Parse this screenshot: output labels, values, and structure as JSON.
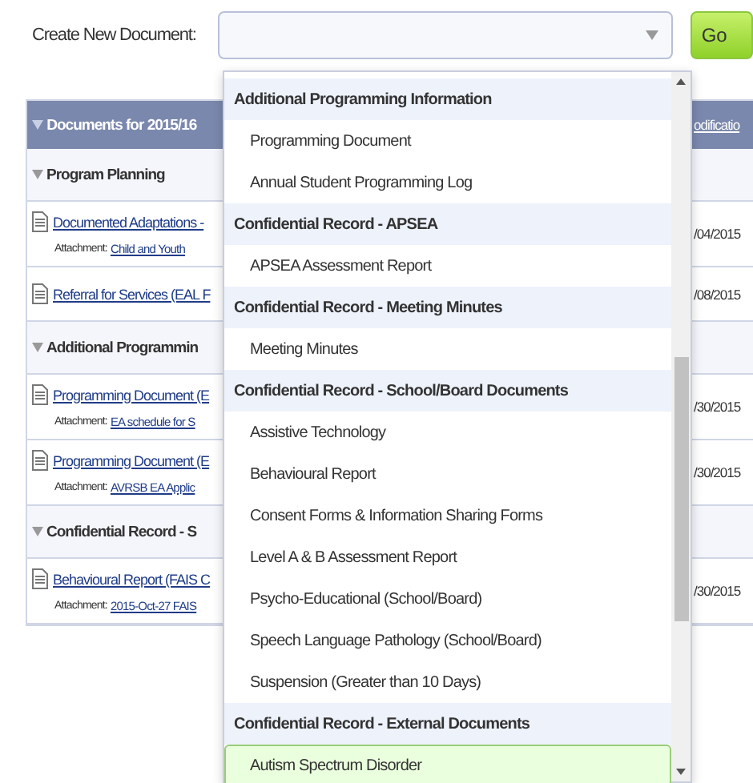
{
  "create": {
    "label": "Create New Document:",
    "button": "Go"
  },
  "table": {
    "title": "Documents for 2015/16",
    "column_2": "odificatio",
    "rows": [
      {
        "kind": "group",
        "title": "Program Planning"
      },
      {
        "kind": "doc",
        "title": "Documented Adaptations -",
        "attachment_label": "Attachment:",
        "attachment": "Child and Youth",
        "date": "/04/2015"
      },
      {
        "kind": "doc",
        "title": "Referral for Services (EAL F",
        "date": "/08/2015"
      },
      {
        "kind": "group",
        "title": "Additional Programmin"
      },
      {
        "kind": "doc",
        "title": "Programming Document (E",
        "attachment_label": "Attachment:",
        "attachment": "EA schedule for S",
        "date": "/30/2015"
      },
      {
        "kind": "doc",
        "title": "Programming Document (E",
        "attachment_label": "Attachment:",
        "attachment": "AVRSB EA Applic",
        "date": "/30/2015"
      },
      {
        "kind": "group",
        "title": "Confidential Record - S"
      },
      {
        "kind": "doc",
        "title": "Behavioural Report (FAIS C",
        "attachment_label": "Attachment:",
        "attachment": "2015-Oct-27 FAIS",
        "date": "/30/2015"
      }
    ]
  },
  "dropdown": {
    "items": [
      {
        "kind": "group",
        "label": "Additional Programming Information",
        "selected": false
      },
      {
        "kind": "option",
        "label": "Programming Document",
        "selected": false
      },
      {
        "kind": "option",
        "label": "Annual Student Programming Log",
        "selected": false
      },
      {
        "kind": "group",
        "label": "Confidential Record - APSEA",
        "selected": false
      },
      {
        "kind": "option",
        "label": "APSEA Assessment Report",
        "selected": false
      },
      {
        "kind": "group",
        "label": "Confidential Record - Meeting Minutes",
        "selected": false
      },
      {
        "kind": "option",
        "label": "Meeting Minutes",
        "selected": false
      },
      {
        "kind": "group",
        "label": "Confidential Record - School/Board Documents",
        "selected": false
      },
      {
        "kind": "option",
        "label": "Assistive Technology",
        "selected": false
      },
      {
        "kind": "option",
        "label": "Behavioural Report",
        "selected": false
      },
      {
        "kind": "option",
        "label": "Consent Forms & Information Sharing Forms",
        "selected": false
      },
      {
        "kind": "option",
        "label": "Level A & B Assessment Report",
        "selected": false
      },
      {
        "kind": "option",
        "label": "Psycho-Educational (School/Board)",
        "selected": false
      },
      {
        "kind": "option",
        "label": "Speech Language Pathology (School/Board)",
        "selected": false
      },
      {
        "kind": "option",
        "label": "Suspension (Greater than 10 Days)",
        "selected": false
      },
      {
        "kind": "group",
        "label": "Confidential Record - External Documents",
        "selected": false
      },
      {
        "kind": "option",
        "label": "Autism Spectrum Disorder",
        "selected": true
      }
    ]
  }
}
